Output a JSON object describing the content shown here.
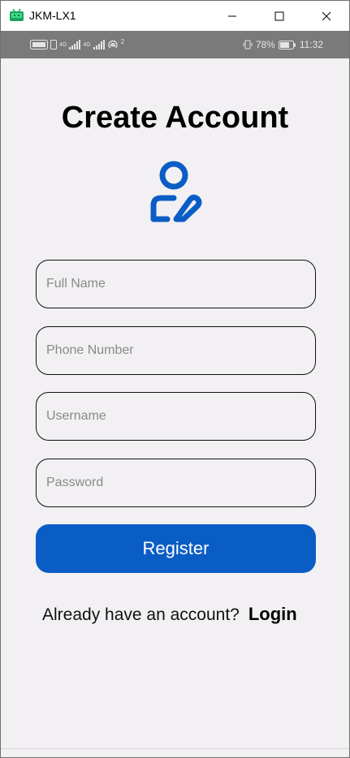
{
  "window": {
    "title": "JKM-LX1"
  },
  "status_bar": {
    "left_labels": [
      "4G",
      "4G"
    ],
    "hotspot_count": "2",
    "battery": "78%",
    "time": "11:32"
  },
  "screen": {
    "title": "Create Account",
    "fields": {
      "full_name": {
        "placeholder": "Full Name",
        "value": ""
      },
      "phone": {
        "placeholder": "Phone Number",
        "value": ""
      },
      "username": {
        "placeholder": "Username",
        "value": ""
      },
      "password": {
        "placeholder": "Password",
        "value": ""
      }
    },
    "register_label": "Register",
    "login_prompt": "Already have an account?",
    "login_link": "Login"
  },
  "colors": {
    "accent": "#0b5dc6",
    "background": "#f2f0f3",
    "status_bar": "#7a7a7a"
  },
  "icons": [
    "android-app-icon",
    "minimize-icon",
    "maximize-icon",
    "close-icon",
    "user-edit-icon"
  ]
}
